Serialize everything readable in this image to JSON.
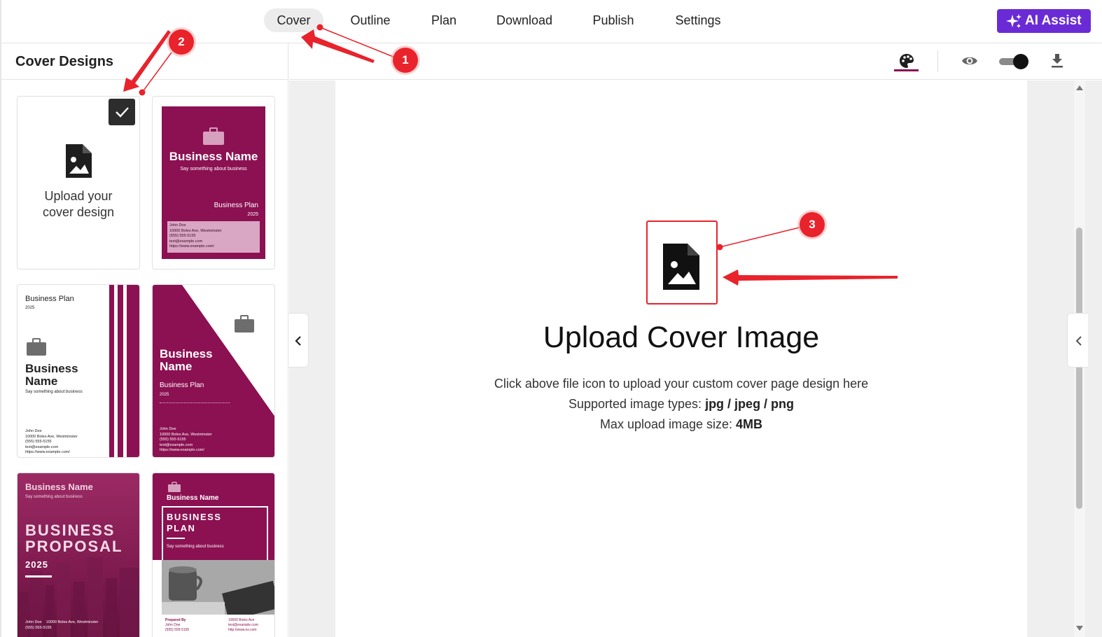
{
  "nav": {
    "tabs": [
      {
        "label": "Cover",
        "active": true
      },
      {
        "label": "Outline",
        "active": false
      },
      {
        "label": "Plan",
        "active": false
      },
      {
        "label": "Download",
        "active": false
      },
      {
        "label": "Publish",
        "active": false
      },
      {
        "label": "Settings",
        "active": false
      }
    ],
    "ai_assist_label": "AI Assist"
  },
  "sidebar": {
    "title": "Cover Designs",
    "upload_card": {
      "line1": "Upload your",
      "line2": "cover design",
      "selected": true
    },
    "templates": {
      "t1": {
        "business_name": "Business Name",
        "tagline": "Say something about business",
        "doc": "Business Plan",
        "year": "2025",
        "contact": [
          "John Doe",
          "10000 Boles Ave, Westminster",
          "(555) 555-5155",
          "text@example.com",
          "https://www.example.com/"
        ]
      },
      "t2": {
        "doc": "Business Plan",
        "year": "2025",
        "business_name_1": "Business",
        "business_name_2": "Name",
        "tagline": "Say something about business",
        "contact": [
          "John Doe",
          "10000 Boles Ave, Westminster",
          "(555) 555-5155",
          "text@example.com",
          "https://www.example.com/"
        ]
      },
      "t3": {
        "business_name_1": "Business",
        "business_name_2": "Name",
        "doc": "Business Plan",
        "year": "2025",
        "contact": [
          "John Doe",
          "10000 Boles Ave, Westminster",
          "(555) 555-5155",
          "text@example.com",
          "https://www.example.com/"
        ]
      },
      "t4": {
        "business_name": "Business Name",
        "tagline": "Say something about business",
        "title_1": "BUSINESS",
        "title_2": "PROPOSAL",
        "year": "2025",
        "contact": [
          "John Doe",
          "10000 Boles Ave, Westminster",
          "(555) 555-5155"
        ]
      },
      "t5": {
        "business_name": "Business Name",
        "title_1": "BUSINESS",
        "title_2": "PLAN",
        "tagline": "Say something about business",
        "prepared_by": "Prepared By",
        "name": "John Doe",
        "phone": "(555) 555-5155",
        "address": "10000 Boles Ave",
        "email": "text@example.com",
        "web": "http://www.ex.com"
      }
    }
  },
  "main": {
    "upload_title": "Upload Cover Image",
    "desc_line1": "Click above file icon to upload your custom cover page design here",
    "desc_line2_prefix": "Supported image types: ",
    "desc_line2_value": "jpg / jpeg / png",
    "desc_line3_prefix": "Max upload image size: ",
    "desc_line3_value": "4MB"
  },
  "annotations": [
    "1",
    "2",
    "3"
  ],
  "colors": {
    "brand": "#8b1152",
    "accent": "#6a2bd6",
    "annotation": "#e8232c"
  }
}
